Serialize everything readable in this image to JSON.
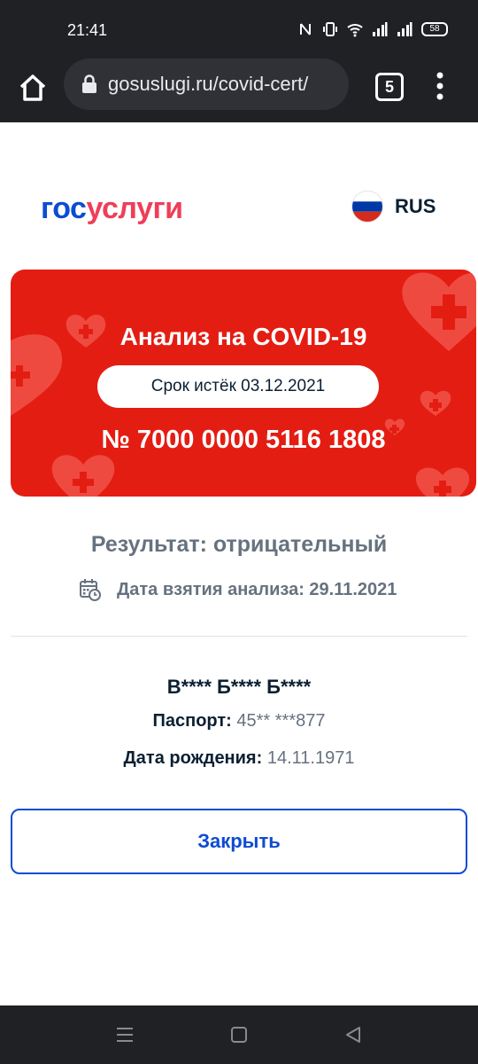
{
  "status": {
    "time": "21:41",
    "battery": "58"
  },
  "browser": {
    "url": "gosuslugi.ru/covid-cert/",
    "tab_count": "5"
  },
  "brand": {
    "part1": "гос",
    "part2": "услуги"
  },
  "lang": "RUS",
  "certificate": {
    "title": "Анализ на COVID-19",
    "expiry": "Срок истёк 03.12.2021",
    "number": "№ 7000 0000 5116 1808"
  },
  "result": "Результат: отрицательный",
  "sample_date": "Дата взятия анализа: 29.11.2021",
  "person": {
    "name": "В**** Б**** Б****",
    "passport_label": "Паспорт:",
    "passport_value": "45** ***877",
    "birth_label": "Дата рождения:",
    "birth_value": "14.11.1971"
  },
  "close_button": "Закрыть",
  "colors": {
    "card_red": "#e41d13",
    "brand_blue": "#0d4cd3",
    "brand_red": "#ee3f58"
  }
}
